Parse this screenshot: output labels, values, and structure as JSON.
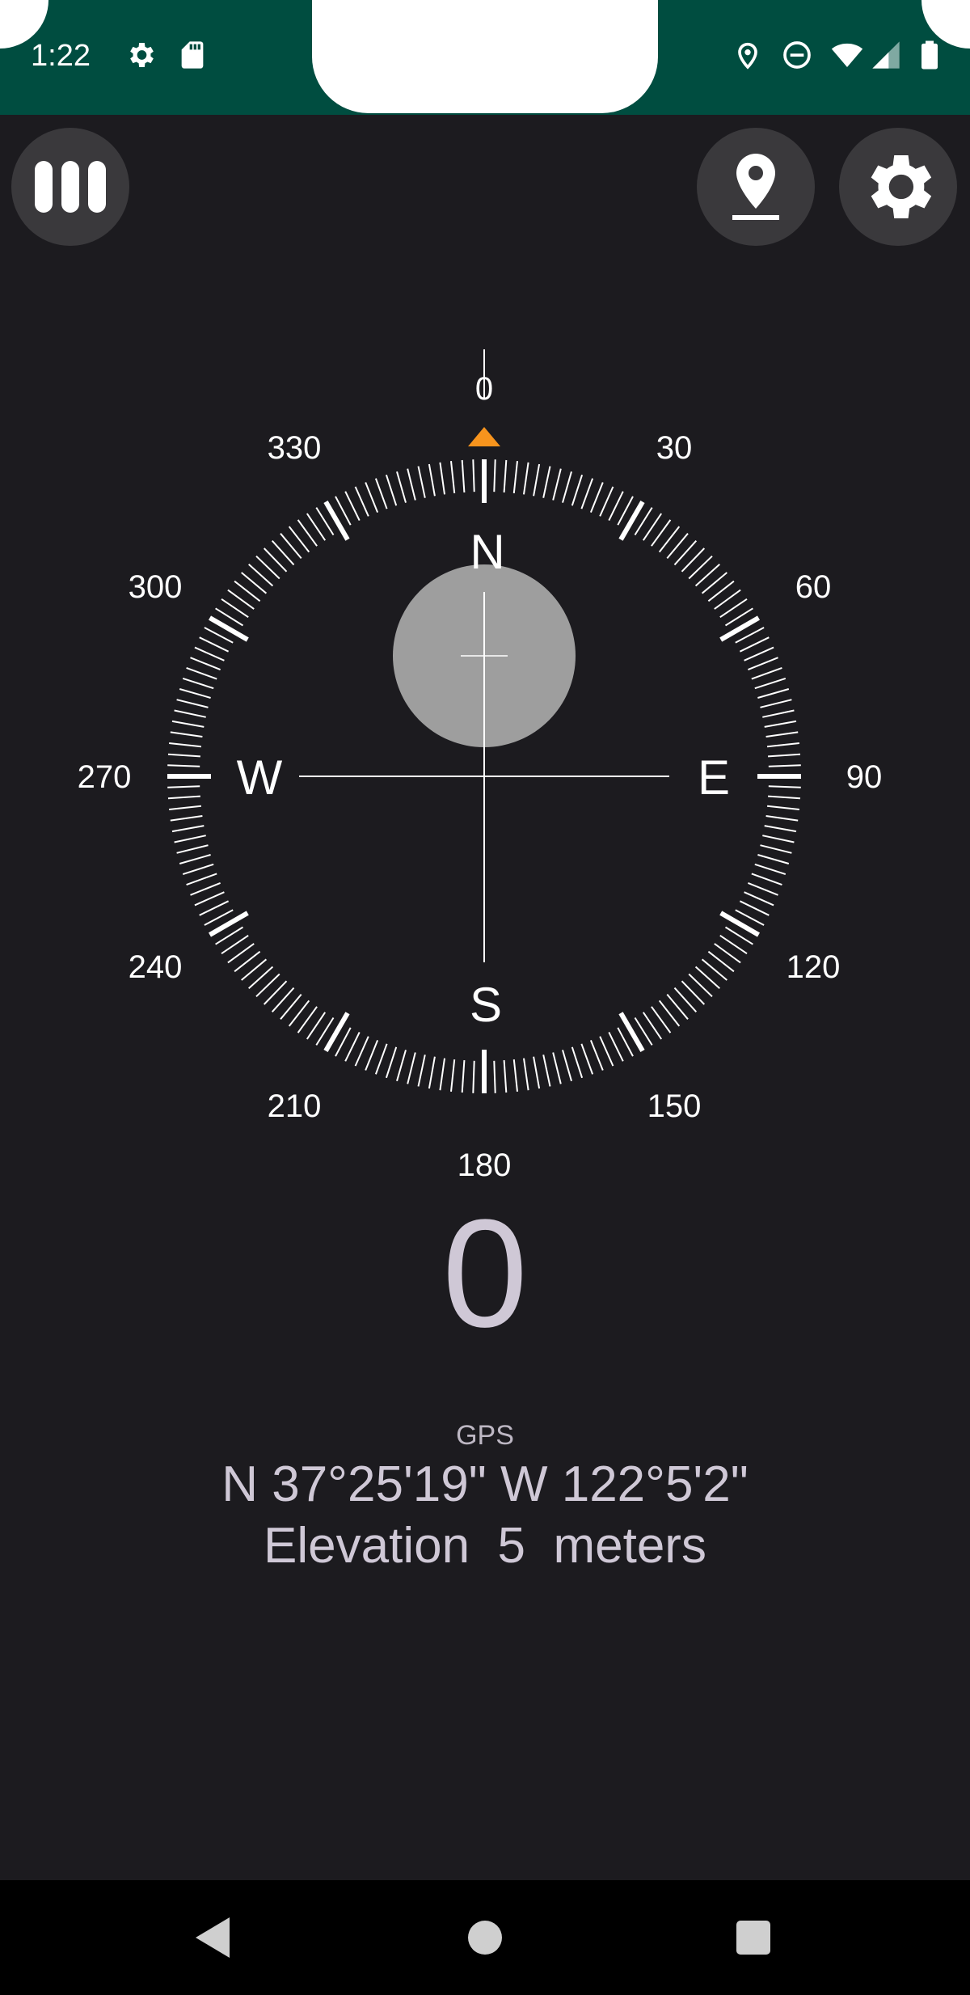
{
  "status_bar": {
    "time": "1:22",
    "icons": [
      "settings-icon",
      "sd-card-icon",
      "location-icon",
      "do-not-disturb-icon",
      "wifi-icon",
      "signal-icon",
      "battery-icon"
    ]
  },
  "toolbar": {
    "menu_icon": "calibrate-bars-icon",
    "location_icon": "location-pin-icon",
    "settings_icon": "gear-icon"
  },
  "compass": {
    "degree_labels": [
      "0",
      "30",
      "60",
      "90",
      "120",
      "150",
      "180",
      "210",
      "240",
      "270",
      "300",
      "330"
    ],
    "cardinals": {
      "n": "N",
      "e": "E",
      "s": "S",
      "w": "W"
    },
    "pointer_color": "#f7941d"
  },
  "reading": {
    "heading": "0",
    "gps_label": "GPS",
    "coordinates": "N 37°25'19\" W 122°5'2\"",
    "elevation": "Elevation  5  meters"
  },
  "nav_bar": {
    "icons": [
      "back-icon",
      "home-icon",
      "recents-icon"
    ]
  }
}
